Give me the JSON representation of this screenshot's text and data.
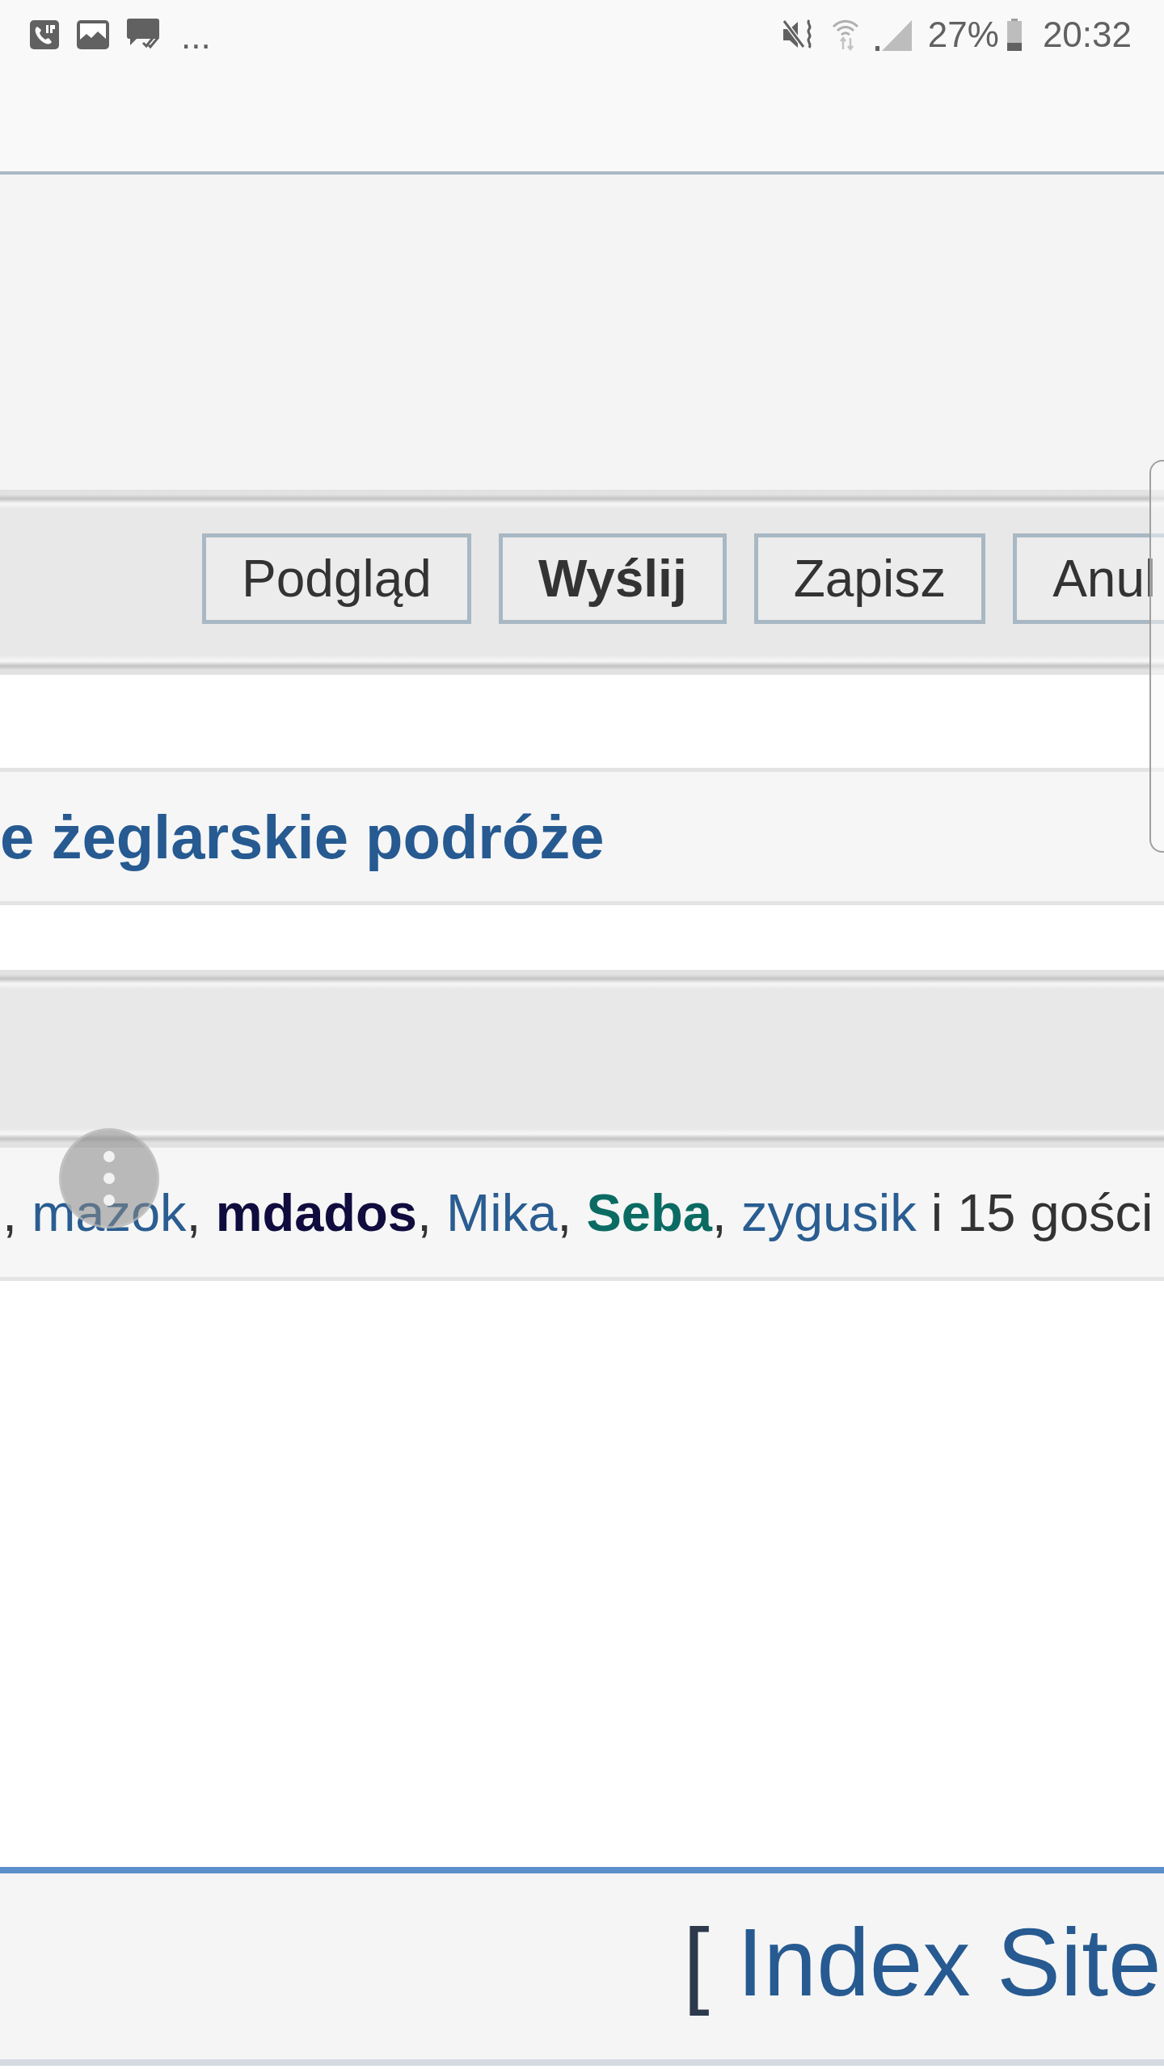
{
  "status_bar": {
    "more_notifications": "...",
    "battery": "27%",
    "time": "20:32"
  },
  "post_buttons": [
    {
      "label": "Podgląd",
      "primary": false
    },
    {
      "label": "Wyślij",
      "primary": true
    },
    {
      "label": "Zapisz",
      "primary": false
    },
    {
      "label": "Anul",
      "primary": false
    }
  ],
  "topic_title": "e żeglarskie podróże",
  "online_users": {
    "lead": ",",
    "users": [
      {
        "name": "mazok",
        "color": "#2a5d91",
        "bold": false,
        "punct": ","
      },
      {
        "name": "mdados",
        "color": "#100c3e",
        "bold": true,
        "punct": ","
      },
      {
        "name": "Mika",
        "color": "#2a5d91",
        "bold": false,
        "punct": ","
      },
      {
        "name": "Seba",
        "color": "#0b6b63",
        "bold": true,
        "punct": ","
      },
      {
        "name": "zygusik",
        "color": "#2a5d91",
        "bold": false
      }
    ],
    "tail": "i 15 gości"
  },
  "footer": {
    "bracket": "[",
    "link": "Index Site"
  }
}
